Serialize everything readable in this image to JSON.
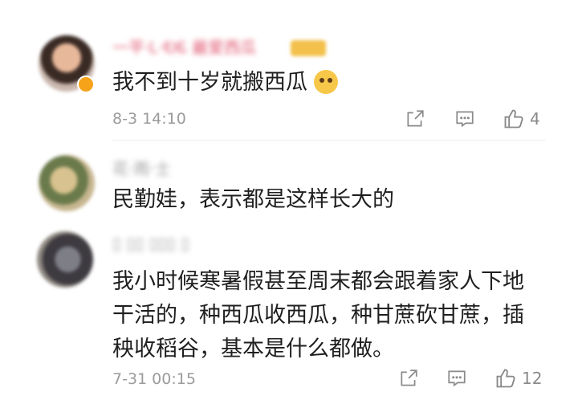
{
  "comments": [
    {
      "username": "一平·Ꮮ·ᎧᏋ 最爱西瓜",
      "text": [
        "我不到十岁就搬西瓜"
      ],
      "time": "8-3 14:10",
      "likes": "4"
    },
    {
      "username": "花·雨·士",
      "text": [
        "民勤娃，表示都是这样长大的"
      ]
    },
    {
      "username": "▯ ▯▯ ▯▯▯ ▯",
      "text": [
        "我小时候寒暑假甚至周末都会跟着家人下地",
        "干活的，种西瓜收西瓜，种甘蔗砍甘蔗，插",
        "秧收稻谷，基本是什么都做。"
      ],
      "time": "7-31 00:15",
      "likes": "12"
    }
  ],
  "colors": {
    "muted": "#9b9b9b",
    "name_pink": "#e0556f",
    "vip_gold": "#f3c04b"
  },
  "icons": {
    "forward": "share-square-icon",
    "comment": "comment-bubble-icon",
    "like": "thumbs-up-icon",
    "emoji": "doge-emoji-icon"
  }
}
